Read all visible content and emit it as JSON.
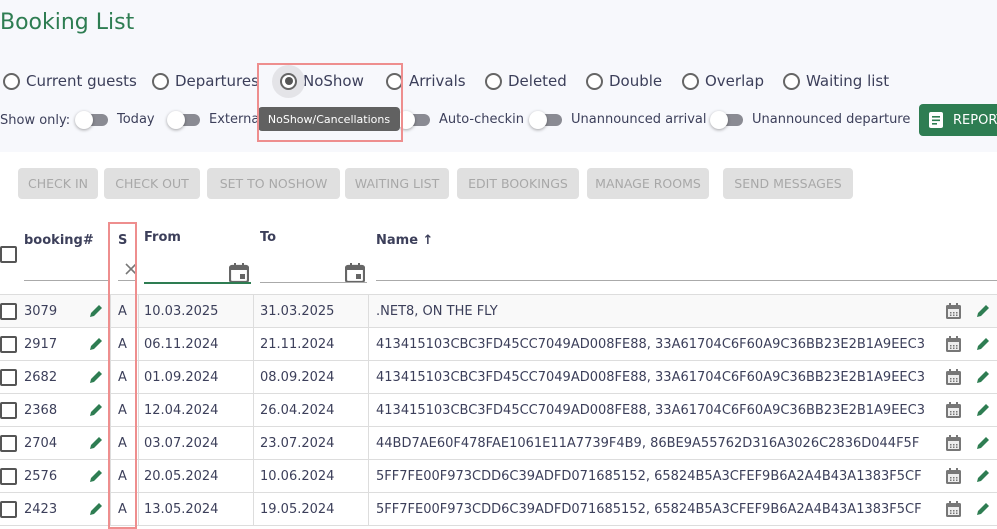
{
  "header": {
    "title": "Booking List"
  },
  "filters": {
    "radios": [
      {
        "label": "Current guests",
        "selected": false
      },
      {
        "label": "Departures",
        "selected": false
      },
      {
        "label": "NoShow",
        "selected": true
      },
      {
        "label": "Arrivals",
        "selected": false
      },
      {
        "label": "Deleted",
        "selected": false
      },
      {
        "label": "Double",
        "selected": false
      },
      {
        "label": "Overlap",
        "selected": false
      },
      {
        "label": "Waiting list",
        "selected": false
      }
    ],
    "show_only_label": "Show only:",
    "toggles": [
      {
        "label": "Today",
        "on": false
      },
      {
        "label": "External",
        "on": false
      },
      {
        "label": "Auto-checkin",
        "on": false
      },
      {
        "label": "Unannounced arrival",
        "on": false
      },
      {
        "label": "Unannounced departure",
        "on": false
      }
    ],
    "tooltip": "NoShow/Cancellations",
    "report_label": "REPORT"
  },
  "actions": [
    "CHECK IN",
    "CHECK OUT",
    "SET TO NOSHOW",
    "WAITING LIST",
    "EDIT BOOKINGS",
    "MANAGE ROOMS",
    "SEND MESSAGES"
  ],
  "table": {
    "columns": {
      "booking": "booking#",
      "status": "S",
      "from": "From",
      "to": "To",
      "name": "Name",
      "sort_indicator": "↑"
    },
    "rows": [
      {
        "booking": "3079",
        "status": "A",
        "from": "10.03.2025",
        "to": "31.03.2025",
        "name": ".NET8, ON THE FLY"
      },
      {
        "booking": "2917",
        "status": "A",
        "from": "06.11.2024",
        "to": "21.11.2024",
        "name": "413415103CBC3FD45CC7049AD008FE88, 33A61704C6F60A9C36BB23E2B1A9EEC3"
      },
      {
        "booking": "2682",
        "status": "A",
        "from": "01.09.2024",
        "to": "08.09.2024",
        "name": "413415103CBC3FD45CC7049AD008FE88, 33A61704C6F60A9C36BB23E2B1A9EEC3"
      },
      {
        "booking": "2368",
        "status": "A",
        "from": "12.04.2024",
        "to": "26.04.2024",
        "name": "413415103CBC3FD45CC7049AD008FE88, 33A61704C6F60A9C36BB23E2B1A9EEC3"
      },
      {
        "booking": "2704",
        "status": "A",
        "from": "03.07.2024",
        "to": "23.07.2024",
        "name": "44BD7AE60F478FAE1061E11A7739F4B9, 86BE9A55762D316A3026C2836D044F5F"
      },
      {
        "booking": "2576",
        "status": "A",
        "from": "20.05.2024",
        "to": "10.06.2024",
        "name": "5FF7FE00F973CDD6C39ADFD071685152, 65824B5A3CFEF9B6A2A4B43A1383F5CF"
      },
      {
        "booking": "2423",
        "status": "A",
        "from": "13.05.2024",
        "to": "19.05.2024",
        "name": "5FF7FE00F973CDD6C39ADFD071685152, 65824B5A3CFEF9B6A2A4B43A1383F5CF"
      }
    ]
  },
  "colors": {
    "accent": "#2e7d52",
    "highlight": "#ee8e8e",
    "tooltip_bg": "#616161"
  }
}
